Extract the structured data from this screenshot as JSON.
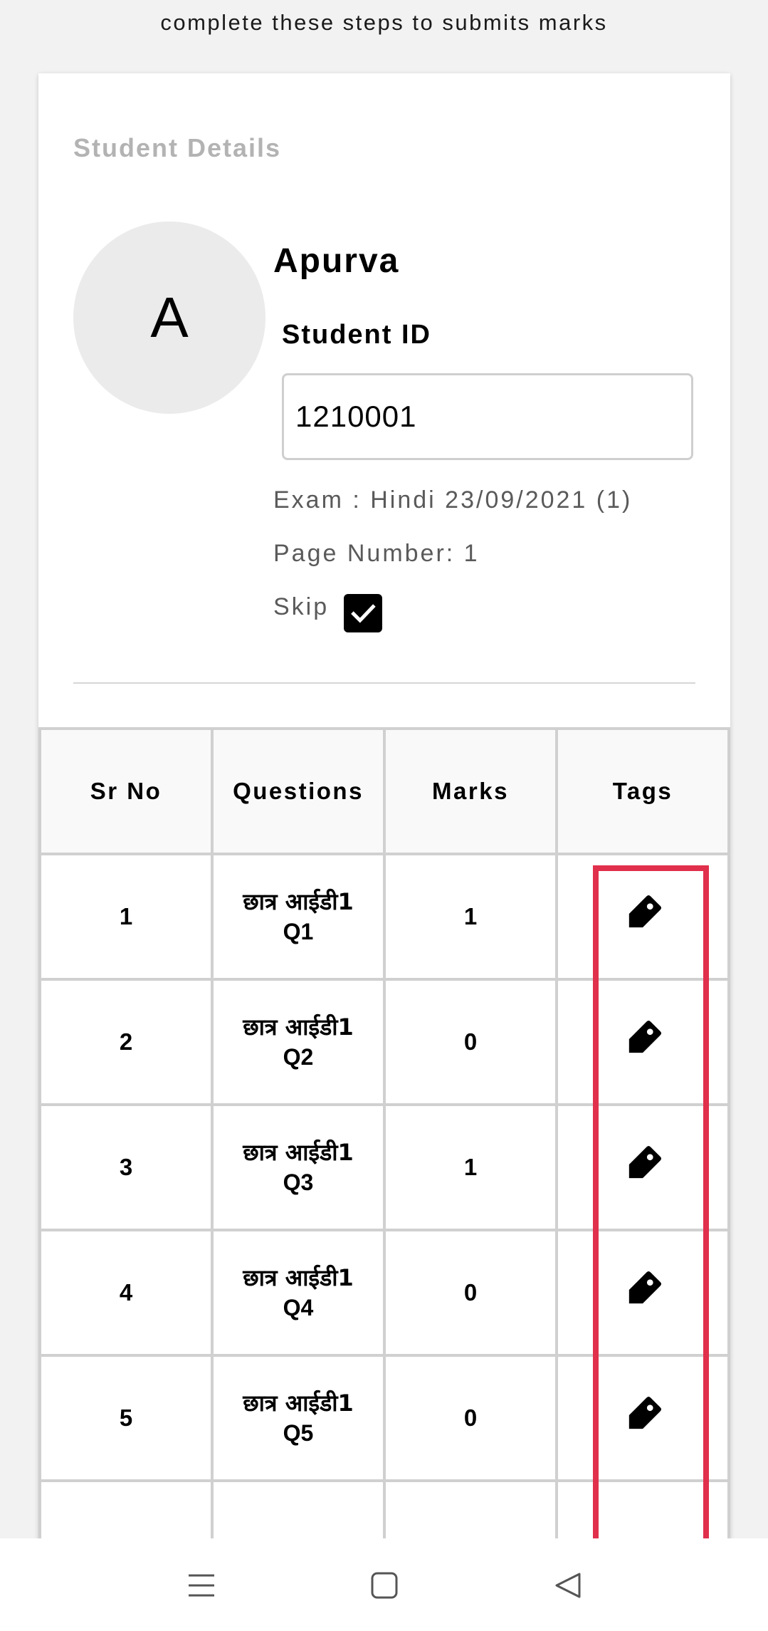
{
  "instruction": "complete these steps to submits marks",
  "student_details": {
    "section_title": "Student Details",
    "avatar_letter": "A",
    "name": "Apurva",
    "id_label": "Student ID",
    "id_value": "1210001",
    "exam": "Exam : Hindi 23/09/2021 (1)",
    "page_number": "Page Number: 1",
    "skip_label": "Skip",
    "skip_checked": true
  },
  "table": {
    "headers": [
      "Sr No",
      "Questions",
      "Marks",
      "Tags"
    ],
    "rows": [
      {
        "sr": "1",
        "question_line1": "छात्र आईडी1",
        "question_line2": "Q1",
        "marks": "1",
        "tag_icon": "tag-icon"
      },
      {
        "sr": "2",
        "question_line1": "छात्र आईडी1",
        "question_line2": "Q2",
        "marks": "0",
        "tag_icon": "tag-icon"
      },
      {
        "sr": "3",
        "question_line1": "छात्र आईडी1",
        "question_line2": "Q3",
        "marks": "1",
        "tag_icon": "tag-icon"
      },
      {
        "sr": "4",
        "question_line1": "छात्र आईडी1",
        "question_line2": "Q4",
        "marks": "0",
        "tag_icon": "tag-icon"
      },
      {
        "sr": "5",
        "question_line1": "छात्र आईडी1",
        "question_line2": "Q5",
        "marks": "0",
        "tag_icon": "tag-icon"
      },
      {
        "sr": "",
        "question_line1": "",
        "question_line2": "",
        "marks": "",
        "tag_icon": ""
      }
    ]
  },
  "highlight_color": "#e0304c",
  "nav_icons": [
    "menu-icon",
    "home-icon",
    "back-icon"
  ]
}
